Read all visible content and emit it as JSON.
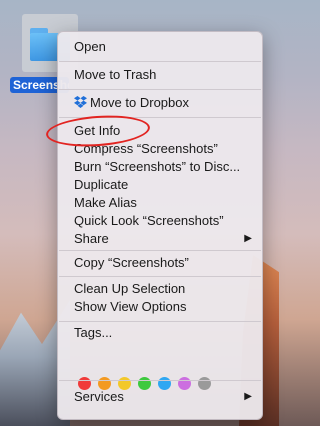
{
  "desktop": {
    "folder_label": "Screenshots"
  },
  "menu": {
    "open": "Open",
    "move_to_trash": "Move to Trash",
    "move_to_dropbox": "Move to Dropbox",
    "get_info": "Get Info",
    "compress": "Compress “Screenshots”",
    "burn": "Burn “Screenshots” to Disc...",
    "duplicate": "Duplicate",
    "make_alias": "Make Alias",
    "quick_look": "Quick Look “Screenshots”",
    "share": "Share",
    "copy": "Copy “Screenshots”",
    "clean_up": "Clean Up Selection",
    "show_view_options": "Show View Options",
    "tags": "Tags...",
    "services": "Services",
    "submenu_arrow": "▶"
  },
  "tag_colors": [
    "#f03a3a",
    "#f39a22",
    "#f3c82a",
    "#3ec93e",
    "#2fa7f2",
    "#cc6fe0",
    "#9a9a9a"
  ],
  "accent": {
    "selection": "#1e63d6",
    "annotation": "#e22421"
  }
}
